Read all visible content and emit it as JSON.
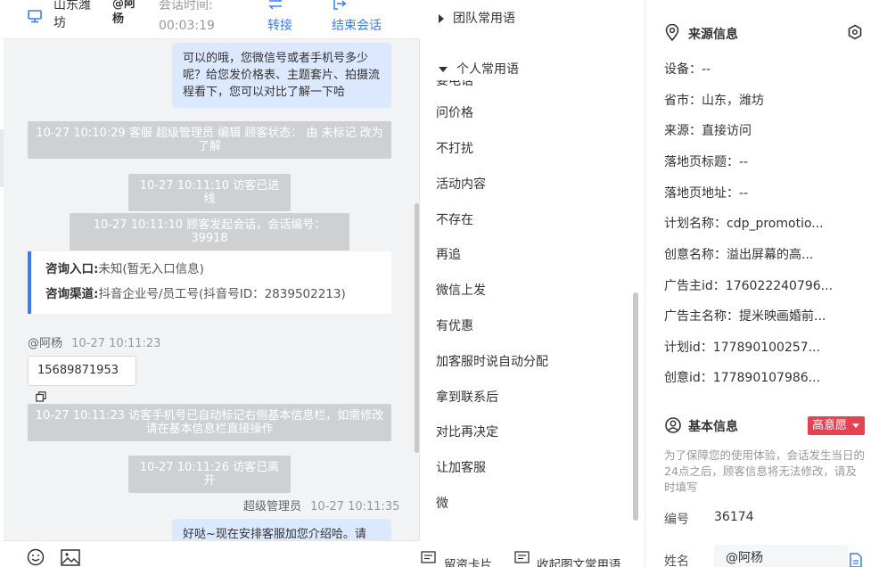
{
  "header": {
    "city": "山东潍坊",
    "agent": "@阿杨",
    "session_time_label": "会话时间:",
    "session_time": "00:03:19",
    "transfer_label": "转接",
    "end_label": "结束会话"
  },
  "messages": {
    "reply_1": "可以的哦，您微信号或者手机号多少呢？给您发价格表、主题套片、拍摄流程看下，您可以对比了解一下哈",
    "sys_edit": "10-27 10:10:29 客服 超级管理员 编辑 顾客状态： 由 未标记 改为 了解",
    "sys_enter": "10-27 10:11:10 访客已进线",
    "sys_start": "10-27 10:11:10 顾客发起会话，会话编号：39918",
    "consult_entry_label": "咨询入口:",
    "consult_entry_value": "未知(暂无入口信息)",
    "consult_channel_label": "咨询渠道:",
    "consult_channel_value": "抖音企业号/员工号(抖音号ID：2839502213)",
    "visitor_name": "@阿杨",
    "visitor_time": "10-27 10:11:23",
    "phone": "15689871953",
    "sys_phone": "10-27 10:11:23 访客手机号已自动标记右侧基本信息栏，如需修改请在基本信息栏直接操作",
    "sys_leave": "10-27 10:11:26 访客已离开",
    "admin_name": "超级管理员",
    "admin_time": "10-27 10:11:35",
    "reply_2": "好哒~现在安排客服加您介绍哈。请"
  },
  "phrases": {
    "team_group": "团队常用语",
    "personal_group": "个人常用语",
    "partial_item": "要电话",
    "items": [
      "问价格",
      "不打扰",
      "活动内容",
      "不存在",
      "再追",
      "微信上发",
      "有优惠",
      "加客服时说自动分配",
      "拿到联系后",
      "对比再决定",
      "让加客服",
      "微"
    ],
    "footer_card": "留资卡片",
    "footer_collapse": "收起图文常用语"
  },
  "source": {
    "title": "来源信息",
    "rows": [
      {
        "label": "设备：",
        "value": "--"
      },
      {
        "label": "省市：",
        "value": "山东，潍坊"
      },
      {
        "label": "来源：",
        "value": "直接访问"
      },
      {
        "label": "落地页标题：",
        "value": "--"
      },
      {
        "label": "落地页地址：",
        "value": "--"
      },
      {
        "label": "计划名称：",
        "value": "cdp_promotio..."
      },
      {
        "label": "创意名称：",
        "value": "溢出屏幕的高..."
      },
      {
        "label": "广告主id：",
        "value": "176022240796..."
      },
      {
        "label": "广告主名称：",
        "value": "提米映画婚前..."
      },
      {
        "label": "计划id：",
        "value": "177890100257..."
      },
      {
        "label": "创意id：",
        "value": "177890107986..."
      }
    ]
  },
  "basic": {
    "title": "基本信息",
    "intent_tag": "高意愿",
    "notice": "为了保障您的使用体验，会话发生当日的24点之后，顾客信息将无法修改，请及时填写",
    "id_label": "编号",
    "id_value": "36174",
    "name_label": "姓名",
    "name_value": "@阿杨"
  },
  "colors": {
    "accent": "#3a7cf4",
    "intent_tag": "#e44452",
    "bubble": "#dbe8fd",
    "system_msg": "#cfd0d2"
  }
}
